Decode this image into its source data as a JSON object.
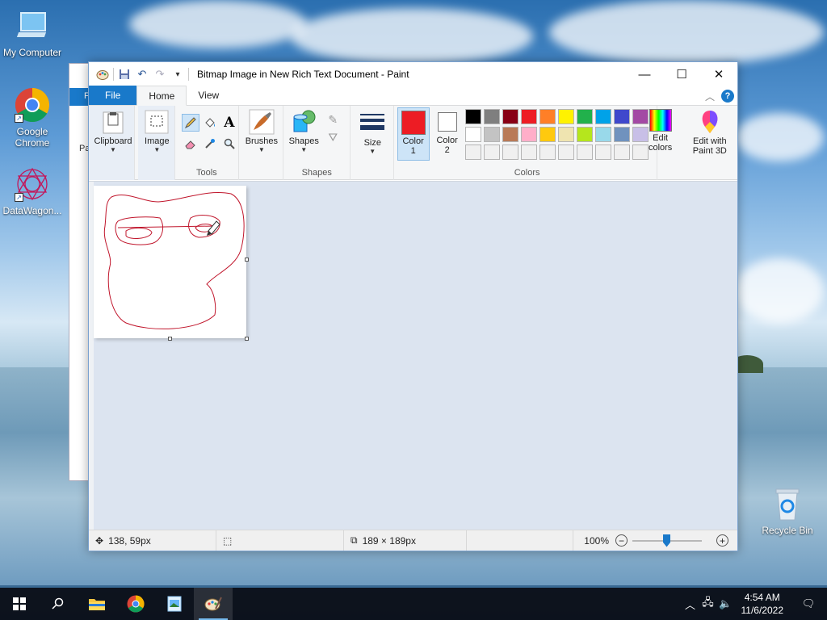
{
  "desktop": {
    "icons": [
      {
        "label": "My Computer",
        "icon": "computer-icon"
      },
      {
        "label": "Google Chrome",
        "icon": "chrome-icon"
      },
      {
        "label": "DataWagon...",
        "icon": "datawagon-icon"
      },
      {
        "label": "Recycle Bin",
        "icon": "recycle-bin-icon"
      }
    ]
  },
  "background_window": {
    "letter": "F",
    "label_fragment": "Pa"
  },
  "paint": {
    "title": "Bitmap Image in New Rich Text Document - Paint",
    "tabs": {
      "file": "File",
      "home": "Home",
      "view": "View"
    },
    "ribbon": {
      "clipboard": "Clipboard",
      "image": "Image",
      "tools_group": "Tools",
      "brushes": "Brushes",
      "shapes": "Shapes",
      "shapes_group": "Shapes",
      "size": "Size",
      "color1_line1": "Color",
      "color1_line2": "1",
      "color2_line1": "Color",
      "color2_line2": "2",
      "edit_colors_line1": "Edit",
      "edit_colors_line2": "colors",
      "paint3d_line1": "Edit with",
      "paint3d_line2": "Paint 3D",
      "colors_group": "Colors"
    },
    "colors": {
      "color1": "#ed1c24",
      "color2": "#ffffff",
      "palette_row1": [
        "#000000",
        "#7f7f7f",
        "#880015",
        "#ed1c24",
        "#ff7f27",
        "#fff200",
        "#22b14c",
        "#00a2e8",
        "#3f48cc",
        "#a349a4"
      ],
      "palette_row2": [
        "#ffffff",
        "#c3c3c3",
        "#b97a57",
        "#ffaec9",
        "#ffc90e",
        "#efe4b0",
        "#b5e61d",
        "#99d9ea",
        "#7092be",
        "#c8bfe7"
      ],
      "palette_row3": [
        "#f0f0f0",
        "#f0f0f0",
        "#f0f0f0",
        "#f0f0f0",
        "#f0f0f0",
        "#f0f0f0",
        "#f0f0f0",
        "#f0f0f0",
        "#f0f0f0",
        "#f0f0f0"
      ]
    },
    "status": {
      "cursor_pos": "138, 59px",
      "image_size": "189 × 189px",
      "zoom": "100%"
    }
  },
  "taskbar": {
    "time": "4:54 AM",
    "date": "11/6/2022"
  }
}
